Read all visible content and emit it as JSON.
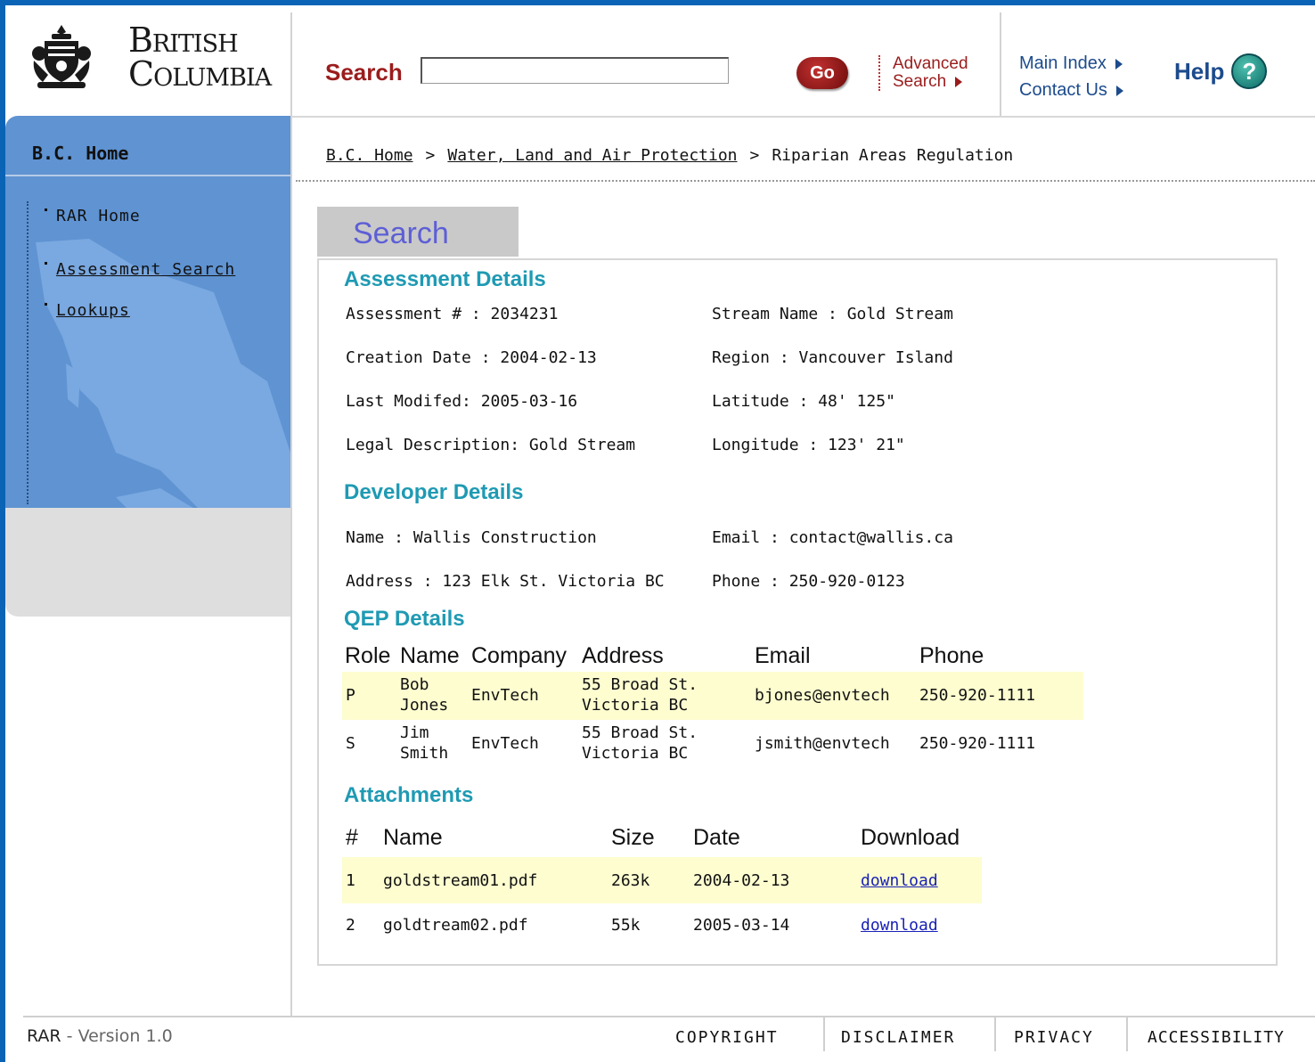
{
  "header": {
    "logo_text_line1": "British",
    "logo_text_line2": "Columbia",
    "search_label": "Search",
    "search_value": "",
    "go_label": "Go",
    "advanced_search_line1": "Advanced",
    "advanced_search_line2": "Search",
    "main_index": "Main Index",
    "contact_us": "Contact Us",
    "help": "Help",
    "help_icon_glyph": "?"
  },
  "sidebar": {
    "title": "B.C. Home",
    "items": [
      {
        "label": "RAR Home",
        "link": false
      },
      {
        "label": "Assessment Search",
        "link": true
      },
      {
        "label": "Lookups",
        "link": true
      }
    ]
  },
  "breadcrumb": {
    "items": [
      "B.C. Home",
      "Water, Land and Air Protection",
      "Riparian Areas Regulation"
    ],
    "separator": ">"
  },
  "page": {
    "tab_title": "Search"
  },
  "assessment": {
    "title": "Assessment Details",
    "assessment_no": "Assessment # : 2034231",
    "creation_date": "Creation Date : 2004-02-13",
    "last_modified": "Last Modifed: 2005-03-16",
    "legal_description": "Legal Description: Gold Stream",
    "stream_name": "Stream Name : Gold Stream",
    "region": "Region : Vancouver Island",
    "latitude": "Latitude : 48' 125\"",
    "longitude": "Longitude : 123' 21\""
  },
  "developer": {
    "title": "Developer Details",
    "name": "Name : Wallis Construction",
    "address": "Address : 123 Elk St. Victoria BC",
    "email": "Email : contact@wallis.ca",
    "phone": "Phone : 250-920-0123"
  },
  "qep": {
    "title": "QEP Details",
    "columns": [
      "Role",
      "Name",
      "Company",
      "Address",
      "Email",
      "Phone"
    ],
    "rows": [
      {
        "role": "P",
        "name1": "Bob",
        "name2": "Jones",
        "company": "EnvTech",
        "address1": "55 Broad St.",
        "address2": "Victoria BC",
        "email": "bjones@envtech",
        "phone": "250-920-1111"
      },
      {
        "role": "S",
        "name1": "Jim",
        "name2": "Smith",
        "company": "EnvTech",
        "address1": "55 Broad St.",
        "address2": "Victoria BC",
        "email": "jsmith@envtech",
        "phone": "250-920-1111"
      }
    ]
  },
  "attachments": {
    "title": "Attachments",
    "columns": [
      "#",
      "Name",
      "Size",
      "Date",
      "Download"
    ],
    "rows": [
      {
        "num": "1",
        "name": "goldstream01.pdf",
        "size": "263k",
        "date": "2004-02-13",
        "download": "download"
      },
      {
        "num": "2",
        "name": "goldtream02.pdf",
        "size": "55k",
        "date": "2005-03-14",
        "download": "download"
      }
    ]
  },
  "footer": {
    "app": "RAR",
    "dash": " - ",
    "version": "Version 1.0",
    "links": [
      "COPYRIGHT",
      "DISCLAIMER",
      "PRIVACY",
      "ACCESSIBILITY"
    ]
  },
  "colors": {
    "frame_blue": "#0a63b5",
    "sidebar_blue": "#5f93d2",
    "search_red": "#9b1c1c",
    "link_navy": "#1c4b8c",
    "section_teal": "#1f9ab3",
    "row_highlight": "#fdfdd0"
  }
}
